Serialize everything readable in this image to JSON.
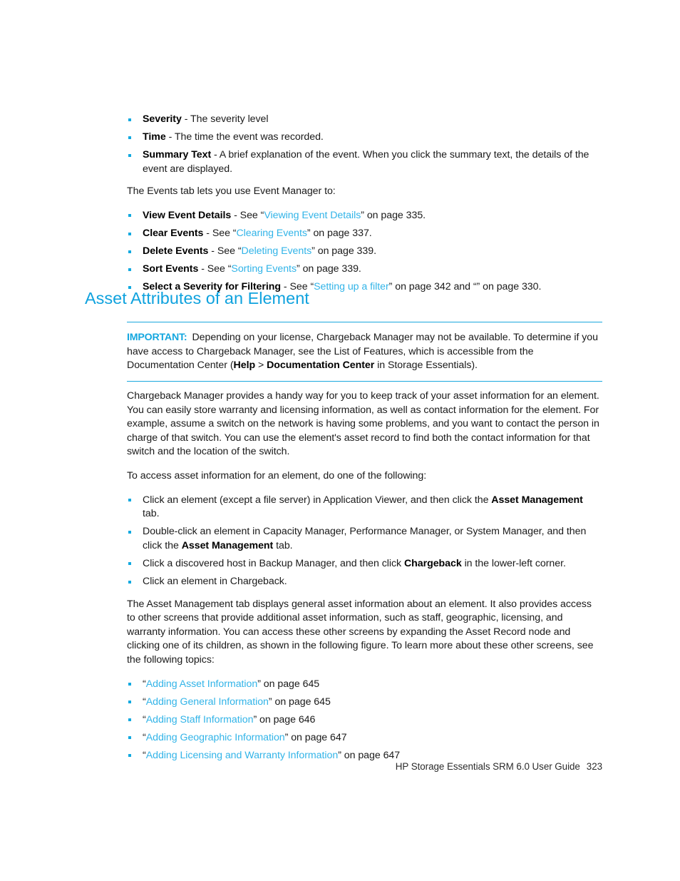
{
  "page": {
    "number": "323",
    "footer_text": "HP Storage Essentials SRM 6.0 User Guide"
  },
  "colors": {
    "heading": "#0FA2DE",
    "link": "#32B4E8",
    "bullet": "#12A9E0",
    "rule": "#1AA8DE",
    "body_text": "#1a1a1a"
  },
  "top_section": {
    "field_bullets": [
      {
        "term": "Severity",
        "rest": " - The severity level"
      },
      {
        "term": "Time",
        "rest": " - The time the event was recorded."
      },
      {
        "term": "Summary Text",
        "rest": " - A brief explanation of the event. When you click the summary text, the details of the event are displayed."
      }
    ],
    "intro_paragraph": "The Events tab lets you use Event Manager to:",
    "task_bullets": [
      {
        "term": "View Event Details",
        "pre": " - See “",
        "link": "Viewing Event Details",
        "post": "” on page 335."
      },
      {
        "term": "Clear Events",
        "pre": " - See “",
        "link": "Clearing Events",
        "post": "” on page 337."
      },
      {
        "term": "Delete Events",
        "pre": " - See “",
        "link": "Deleting Events",
        "post": "” on page 339."
      },
      {
        "term": "Sort Events",
        "pre": " - See “",
        "link": "Sorting Events",
        "post": "” on page 339."
      },
      {
        "term": "Select a Severity for Filtering",
        "pre": " - See “",
        "link": "Setting up a filter",
        "post": "” on page 342 and “” on page 330."
      }
    ]
  },
  "heading": "Asset Attributes of an Element",
  "note": {
    "label": "IMPORTANT:",
    "text_1": "Depending on your license, Chargeback Manager may not be available. To determine if you have access to Chargeback Manager, see the List of Features, which is accessible from the Documentation Center (",
    "bold_1": "Help",
    "text_2": " > ",
    "bold_2": "Documentation Center",
    "text_3": " in Storage Essentials)."
  },
  "body": {
    "paragraph_1": "Chargeback Manager provides a handy way for you to keep track of your asset information for an element. You can easily store warranty and licensing information, as well as contact information for the element. For example, assume a switch on the network is having some problems, and you want to contact the person in charge of that switch. You can use the element's asset record to find both the contact information for that switch and the location of the switch.",
    "paragraph_2": "To access asset information for an element, do one of the following:",
    "access_bullets": [
      {
        "pre": "Click an element (except a file server) in Application Viewer, and then click the ",
        "bold": "Asset Management",
        "post": " tab."
      },
      {
        "pre": "Double-click an element in Capacity Manager, Performance Manager, or System Manager, and then click the ",
        "bold": "Asset Management",
        "post": " tab."
      },
      {
        "pre": "Click a discovered host in Backup Manager, and then click ",
        "bold": "Chargeback",
        "post": " in the lower-left corner."
      },
      {
        "pre": "Click an element in Chargeback.",
        "bold": "",
        "post": ""
      }
    ],
    "paragraph_3": "The Asset Management tab displays general asset information about an element. It also provides access to other screens that provide additional asset information, such as staff, geographic, licensing, and warranty information. You can access these other screens by expanding the Asset Record node and clicking one of its children, as shown in the following figure. To learn more about these other screens, see the following topics:",
    "topic_bullets": [
      {
        "pre": "“",
        "link": "Adding Asset Information",
        "post": "” on page 645"
      },
      {
        "pre": "“",
        "link": "Adding General Information",
        "post": "” on page 645"
      },
      {
        "pre": "“",
        "link": "Adding Staff Information",
        "post": "” on page 646"
      },
      {
        "pre": "“",
        "link": "Adding Geographic Information",
        "post": "” on page 647"
      },
      {
        "pre": "“",
        "link": "Adding Licensing and Warranty Information",
        "post": "” on page 647"
      }
    ]
  }
}
